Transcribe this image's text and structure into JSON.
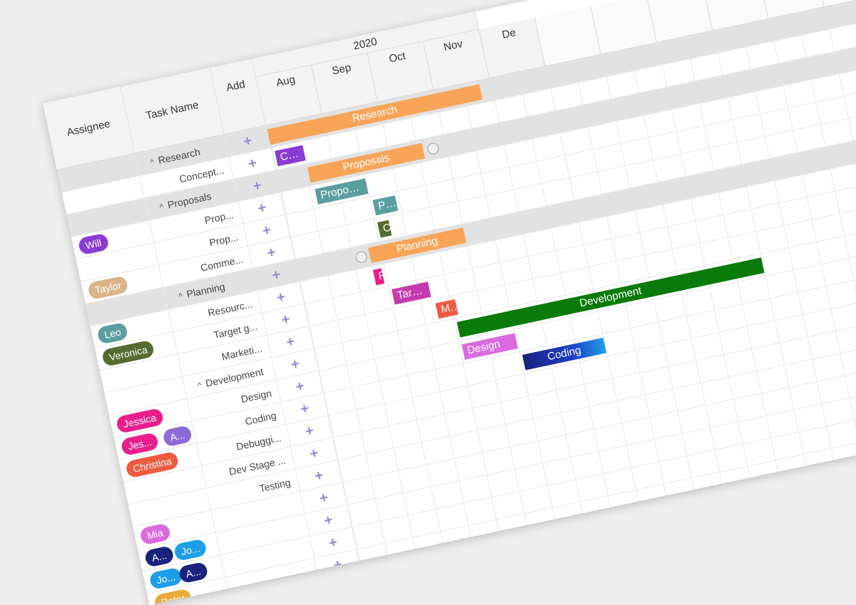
{
  "headers": {
    "assignee": "Assignee",
    "task_name": "Task Name",
    "add": "Add"
  },
  "add_icon": "+",
  "year": "2020",
  "months": [
    "Aug",
    "Sep",
    "Oct",
    "Nov",
    "De"
  ],
  "tasks": [
    {
      "name": "Research",
      "level": 0,
      "assignees": [],
      "bar": {
        "label": "Research",
        "color": "#f7a457",
        "start": 0,
        "end": 3.8
      }
    },
    {
      "name": "Concept...",
      "level": 1,
      "assignees": [],
      "bar": {
        "label": "Conce...",
        "color": "#8a3bd6",
        "start": 0.05,
        "end": 0.55
      }
    },
    {
      "name": "Proposals",
      "level": 0,
      "assignees": [],
      "bar": {
        "label": "Proposals",
        "color": "#f7a457",
        "start": 0.55,
        "end": 2.6
      }
    },
    {
      "name": "Prop...",
      "level": 1,
      "assignees": [
        {
          "name": "Will",
          "color": "#8a3bd6"
        }
      ],
      "bar": {
        "label": "Proposal Develop...",
        "color": "#5a9ea0",
        "start": 0.6,
        "end": 1.5
      }
    },
    {
      "name": "Prop...",
      "level": 1,
      "assignees": [],
      "bar": {
        "label": "Propos...",
        "color": "#5a9ea0",
        "start": 1.55,
        "end": 1.95
      }
    },
    {
      "name": "Comme...",
      "level": 1,
      "assignees": [
        {
          "name": "Taylor",
          "color": "#d8b488"
        }
      ],
      "bar": {
        "label": "Co...",
        "color": "#556b2f",
        "start": 1.55,
        "end": 1.75
      }
    },
    {
      "name": "Planning",
      "level": 0,
      "assignees": [],
      "bar": {
        "label": "Planning",
        "color": "#f7a457",
        "start": 1.3,
        "end": 3.0
      }
    },
    {
      "name": "Resourc...",
      "level": 1,
      "assignees": [
        {
          "name": "Leo",
          "color": "#5a9ea0"
        }
      ],
      "bar": {
        "label": "R...",
        "color": "#e91e8c",
        "start": 1.3,
        "end": 1.45
      }
    },
    {
      "name": "Target g...",
      "level": 1,
      "assignees": [
        {
          "name": "Veronica",
          "color": "#556b2f"
        }
      ],
      "bar": {
        "label": "Target group ...",
        "color": "#c43bb0",
        "start": 1.55,
        "end": 2.2
      }
    },
    {
      "name": "Marketi...",
      "level": 1,
      "assignees": [],
      "bar": {
        "label": "Market...",
        "color": "#f05a40",
        "start": 2.25,
        "end": 2.6
      }
    },
    {
      "name": "Development",
      "level": 0,
      "assignees": [],
      "bar": {
        "label": "Development",
        "color": "#0a7a0a",
        "start": 2.55,
        "end": 8.0
      }
    },
    {
      "name": "Design",
      "level": 1,
      "assignees": [
        {
          "name": "Jessica",
          "color": "#e91e8c"
        }
      ],
      "bar": {
        "label": "Design",
        "color": "#da6adf",
        "start": 2.55,
        "end": 3.5
      }
    },
    {
      "name": "Coding",
      "level": 1,
      "assignees": [
        {
          "name": "Jes...",
          "color": "#e91e8c"
        },
        {
          "name": "A...",
          "color": "#8c6bd6"
        }
      ],
      "bar": {
        "label": "Coding",
        "color": "#1e3fc8",
        "start": 3.55,
        "end": 5.0
      }
    },
    {
      "name": "Debuggi...",
      "level": 1,
      "assignees": [
        {
          "name": "Christina",
          "color": "#f05a40"
        }
      ],
      "bar": null
    },
    {
      "name": "Dev Stage ...",
      "level": 1,
      "assignees": [],
      "bar": null
    },
    {
      "name": "Testing",
      "level": 1,
      "assignees": [],
      "bar": null
    },
    {
      "name": "",
      "level": 1,
      "assignees": [
        {
          "name": "Mia",
          "color": "#da6adf"
        }
      ],
      "bar": null
    },
    {
      "name": "",
      "level": 1,
      "assignees": [
        {
          "name": "A...",
          "color": "#1a237e"
        },
        {
          "name": "Jo...",
          "color": "#1e9ee8"
        }
      ],
      "bar": null
    },
    {
      "name": "",
      "level": 1,
      "assignees": [
        {
          "name": "Jo...",
          "color": "#1e9ee8"
        },
        {
          "name": "A...",
          "color": "#1a237e"
        }
      ],
      "bar": null
    },
    {
      "name": "",
      "level": 1,
      "assignees": [
        {
          "name": "Peter",
          "color": "#e8a93a"
        }
      ],
      "bar": null
    }
  ]
}
